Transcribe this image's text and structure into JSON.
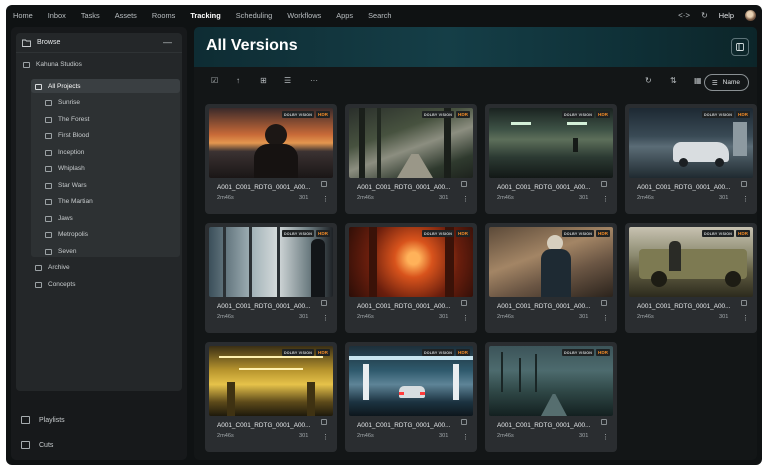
{
  "nav": {
    "items": [
      "Home",
      "Inbox",
      "Tasks",
      "Assets",
      "Rooms",
      "Tracking",
      "Scheduling",
      "Workflows",
      "Apps",
      "Search"
    ],
    "active": "Tracking",
    "help": "Help"
  },
  "sidebar": {
    "browse_label": "Browse",
    "studio": "Kahuna Studios",
    "all_projects": "All Projects",
    "projects": [
      "Sunrise",
      "The Forest",
      "First Blood",
      "Inception",
      "Whiplash",
      "Star Wars",
      "The Martian",
      "Jaws",
      "Metropolis",
      "Seven"
    ],
    "archive": "Archive",
    "concepts": "Concepts",
    "playlists": "Playlists",
    "cuts": "Cuts"
  },
  "main": {
    "title": "All Versions",
    "sort_label": "Name"
  },
  "badges": {
    "dolby": "DOLBY VISION",
    "hdr": "HDR"
  },
  "colors": {
    "hdr": "#f08a26",
    "header_teal": "#153e47"
  },
  "cards": [
    {
      "name": "A001_C001_RDTG_0001_A00...",
      "duration": "2m46s",
      "frames": "301"
    },
    {
      "name": "A001_C001_RDTG_0001_A00...",
      "duration": "2m46s",
      "frames": "301"
    },
    {
      "name": "A001_C001_RDTG_0001_A00...",
      "duration": "2m46s",
      "frames": "301"
    },
    {
      "name": "A001_C001_RDTG_0001_A00...",
      "duration": "2m46s",
      "frames": "301"
    },
    {
      "name": "A001_C001_RDTG_0001_A00...",
      "duration": "2m46s",
      "frames": "301"
    },
    {
      "name": "A001_C001_RDTG_0001_A00...",
      "duration": "2m46s",
      "frames": "301"
    },
    {
      "name": "A001_C001_RDTG_0001_A00...",
      "duration": "2m46s",
      "frames": "301"
    },
    {
      "name": "A001_C001_RDTG_0001_A00...",
      "duration": "2m46s",
      "frames": "301"
    },
    {
      "name": "A001_C001_RDTG_0001_A00...",
      "duration": "2m46s",
      "frames": "301"
    },
    {
      "name": "A001_C001_RDTG_0001_A00...",
      "duration": "2m46s",
      "frames": "301"
    },
    {
      "name": "A001_C001_RDTG_0001_A00...",
      "duration": "2m46s",
      "frames": "301"
    }
  ]
}
